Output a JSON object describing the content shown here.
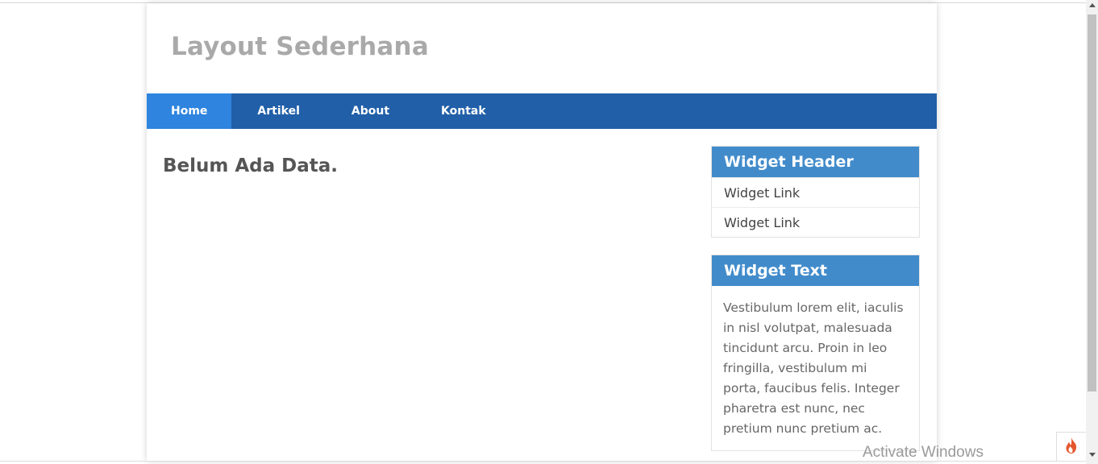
{
  "site": {
    "title": "Layout Sederhana"
  },
  "nav": {
    "items": [
      {
        "label": "Home",
        "active": true
      },
      {
        "label": "Artikel",
        "active": false
      },
      {
        "label": "About",
        "active": false
      },
      {
        "label": "Kontak",
        "active": false
      }
    ]
  },
  "main": {
    "message": "Belum Ada Data."
  },
  "widgets": [
    {
      "header": "Widget Header",
      "links": [
        "Widget Link",
        "Widget Link"
      ]
    },
    {
      "header": "Widget Text",
      "text": "Vestibulum lorem elit, iaculis in nisl volutpat, malesuada tincidunt arcu. Proin in leo fringilla, vestibulum mi porta, faucibus felis. Integer pharetra est nunc, nec pretium nunc pretium ac."
    }
  ],
  "overlay": {
    "watermark": "Activate Windows",
    "flame_icon": "flame-icon"
  },
  "colors": {
    "nav_bg": "#215fa8",
    "nav_active": "#2e84de",
    "widget_header": "#418bcb",
    "title_gray": "#a9a9a9"
  }
}
